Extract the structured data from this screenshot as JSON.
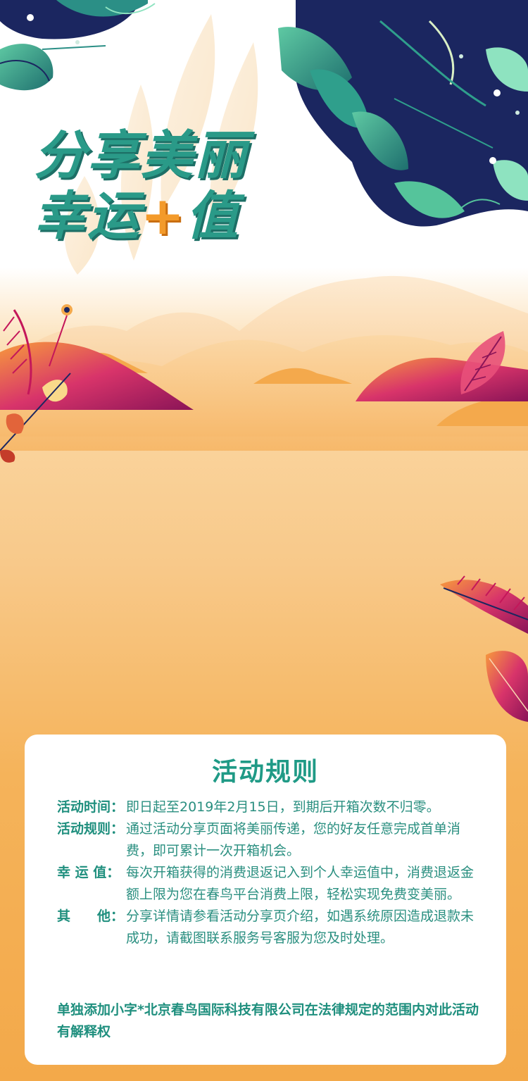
{
  "banner": {
    "title_line1": "分享美丽",
    "title_line2_part1": "幸运",
    "title_line2_plus": "+",
    "title_line2_part2": "值"
  },
  "rules": {
    "title": "活动规则",
    "items": [
      {
        "label": "活动时间：",
        "text": "即日起至2019年2月15日，到期后开箱次数不归零。"
      },
      {
        "label": "活动规则：",
        "text": "通过活动分享页面将美丽传递，您的好友任意完成首单消费，即可累计一次开箱机会。"
      },
      {
        "label": "幸 运 值：",
        "text": "每次开箱获得的消费退返记入到个人幸运值中，消费退返金额上限为您在春鸟平台消费上限，轻松实现免费变美丽。"
      },
      {
        "label": "其　　他：",
        "text": "分享详情请参看活动分享页介绍，如遇系统原因造成退款未成功，请截图联系服务号客服为您及时处理。"
      }
    ],
    "note": "单独添加小字*北京春鸟国际科技有限公司在法律规定的范围内对此活动有解释权"
  },
  "colors": {
    "accent_teal": "#1f9a86",
    "accent_orange": "#f39a2a",
    "navy": "#1b2660",
    "magenta": "#c4175a"
  }
}
